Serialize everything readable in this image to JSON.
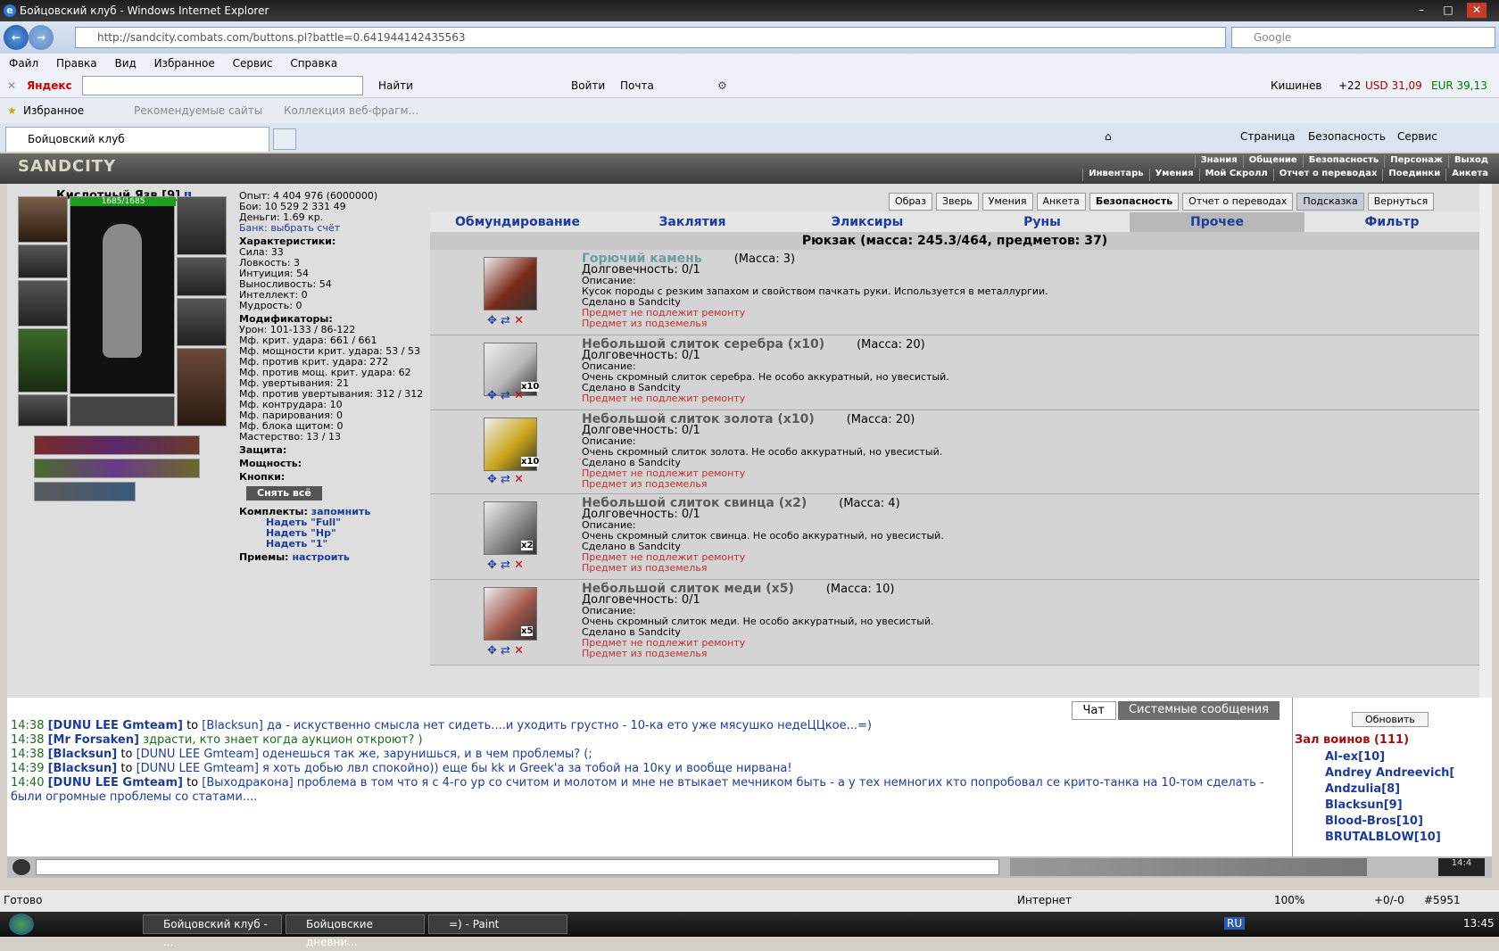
{
  "window": {
    "title": "Бойцовский клуб - Windows Internet Explorer"
  },
  "address": {
    "url": "http://sandcity.combats.com/buttons.pl?battle=0.641944142435563",
    "search_placeholder": "Google"
  },
  "menu": [
    "Файл",
    "Правка",
    "Вид",
    "Избранное",
    "Сервис",
    "Справка"
  ],
  "yandex": {
    "brand": "Яндекс",
    "find": "Найти",
    "login": "Войти",
    "mail": "Почта",
    "city": "Кишинев",
    "temp": "+22",
    "usd": "USD 31,09",
    "eur": "EUR 39,13"
  },
  "favorites": {
    "label": "Избранное",
    "recommended": "Рекомендуемые сайты",
    "collection": "Коллекция веб-фрагм..."
  },
  "tab": {
    "title": "Бойцовский клуб",
    "page": "Страница",
    "security": "Безопасность",
    "service": "Сервис"
  },
  "game": {
    "logo": "SANDCITY",
    "topnav_row1": [
      "Знания",
      "Общение",
      "Безопасность",
      "Персонаж",
      "Выход"
    ],
    "topnav_row2": [
      "Инвентарь",
      "Умения",
      "Мой Скролл",
      "Отчет о переводах",
      "Поединки",
      "Анкета"
    ],
    "char_name": "Кислотный Язв",
    "char_level": "[9]",
    "hp": "1685/1685",
    "stats_top": {
      "exp": "Опыт: 4 404 976 (6000000)",
      "fights": "Бои: 10 529  2 331  49",
      "money": "Деньги: 1.69 кр.",
      "bank": "Банк: выбрать счёт"
    },
    "chars_title": "Характеристики:",
    "chars": [
      "Сила: 33",
      "Ловкость: 3",
      "Интуиция: 54",
      "Выносливость: 54",
      "Интеллект: 0",
      "Мудрость: 0"
    ],
    "mods_title": "Модификаторы:",
    "mods": [
      "Урон: 101-133 / 86-122",
      "Мф. крит. удара: 661 / 661",
      "Мф. мощности крит. удара: 53 / 53",
      "Мф. против крит. удара: 272",
      "Мф. против мощ. крит. удара: 62",
      "Мф. увертывания: 21",
      "Мф. против увертывания: 312 / 312",
      "Мф. контрудара: 10",
      "Мф. парирования: 0",
      "Мф. блока щитом: 0",
      "Мастерство: 13 / 13"
    ],
    "sections": [
      "Защита:",
      "Мощность:",
      "Кнопки:"
    ],
    "undress": "Снять всё",
    "sets_title": "Комплекты:",
    "sets_remember": "запомнить",
    "sets": [
      "Надеть \"Full\"",
      "Надеть \"Hp\"",
      "Надеть \"1\""
    ],
    "tricks_title": "Приемы:",
    "tricks_setup": "настроить",
    "buttons": [
      "Образ",
      "Зверь",
      "Умения",
      "Анкета",
      "Безопасность",
      "Отчет о переводах",
      "Подсказка",
      "Вернуться"
    ],
    "categories": [
      "Обмундирование",
      "Заклятия",
      "Эликсиры",
      "Руны",
      "Прочее",
      "Фильтр"
    ],
    "bag_title": "Рюкзак (масса: 245.3/464, предметов: 37)",
    "items": [
      {
        "name": "Горючий камень",
        "mass": "(Масса: 3)",
        "dur": "Долговечность: 0/1",
        "desc_label": "Описание:",
        "desc": "Кусок породы с резким запахом и свойством пачкать руки. Используется в металлургии.",
        "made": "Сделано в Sandcity",
        "no_repair": "Предмет не подлежит ремонту",
        "from": "Предмет из подземелья",
        "qty": "",
        "color": "#7a2a1a"
      },
      {
        "name": "Небольшой слиток серебра (x10)",
        "mass": "(Масса: 20)",
        "dur": "Долговечность: 0/1",
        "desc_label": "Описание:",
        "desc": "Очень скромный слиток серебра. Не особо аккуратный, но увесистый.",
        "made": "Сделано в Sandcity",
        "no_repair": "Предмет не подлежит ремонту",
        "from": "",
        "qty": "x10",
        "color": "#b8b8b8"
      },
      {
        "name": "Небольшой слиток золота (x10)",
        "mass": "(Масса: 20)",
        "dur": "Долговечность: 0/1",
        "desc_label": "Описание:",
        "desc": "Очень скромный слиток золота. Не особо аккуратный, но увесистый.",
        "made": "Сделано в Sandcity",
        "no_repair": "Предмет не подлежит ремонту",
        "from": "Предмет из подземелья",
        "qty": "x10",
        "color": "#c9a516"
      },
      {
        "name": "Небольшой слиток свинца (x2)",
        "mass": "(Масса: 4)",
        "dur": "Долговечность: 0/1",
        "desc_label": "Описание:",
        "desc": "Очень скромный слиток свинца. Не особо аккуратный, но увесистый.",
        "made": "Сделано в Sandcity",
        "no_repair": "Предмет не подлежит ремонту",
        "from": "Предмет из подземелья",
        "qty": "x2",
        "color": "#8a8a8a"
      },
      {
        "name": "Небольшой слиток меди (x5)",
        "mass": "(Масса: 10)",
        "dur": "Долговечность: 0/1",
        "desc_label": "Описание:",
        "desc": "Очень скромный слиток меди. Не особо аккуратный, но увесистый.",
        "made": "Сделано в Sandcity",
        "no_repair": "Предмет не подлежит ремонту",
        "from": "Предмет из подземелья",
        "qty": "x5",
        "color": "#a0584a"
      }
    ]
  },
  "chat": {
    "tab_chat": "Чат",
    "tab_system": "Системные сообщения",
    "lines": [
      {
        "time": "14:38",
        "who": "[DUNU LEE Gmteam]",
        "to": "to",
        "target": "[Blacksun]",
        "msg": "да - искуственно смысла нет сидеть....и уходить грустно - 10-ка ето уже мясушко недеЦЦкое...=)"
      },
      {
        "time": "14:38",
        "who": "[Mr Forsaken]",
        "to": "",
        "target": "",
        "msg": "здрасти, кто знает когда аукцион откроют? )"
      },
      {
        "time": "14:38",
        "who": "[Blacksun]",
        "to": "to",
        "target": "[DUNU LEE Gmteam]",
        "msg": "оденешься так же, зарунишься, и в чем проблемы? (;"
      },
      {
        "time": "14:39",
        "who": "[Blacksun]",
        "to": "to",
        "target": "[DUNU LEE Gmteam]",
        "msg": "я хоть добью лвл спокойно)) еще бы kk и Greek'а за тобой на 10ку и вообще нирвана!"
      },
      {
        "time": "14:40",
        "who": "[DUNU LEE Gmteam]",
        "to": "to",
        "target": "[Выходракона]",
        "msg": "проблема в том что я с 4-го ур со считом и молотом и мне не втыкает мечником быть - а у тех немногих кто попробовал се крито-танка на 10-том сделать - были огромные проблемы со статами...."
      }
    ]
  },
  "warriors": {
    "refresh": "Обновить",
    "title": "Зал воинов (111)",
    "list": [
      "Al-ex[10]",
      "Andrey Andreevich[",
      "Andzulia[8]",
      "Blacksun[9]",
      "Blood-Bros[10]",
      "BRUTALBLOW[10]"
    ]
  },
  "statusbar": {
    "ready": "Готово",
    "zone": "Интернет",
    "zoom": "100%",
    "extra": "+0/-0",
    "num": "#5951"
  },
  "taskbar": {
    "t1": "Бойцовский клуб - ...",
    "t2": "Бойцовские дневни...",
    "t3": "=) - Paint",
    "lang": "RU",
    "clock": "13:45"
  }
}
